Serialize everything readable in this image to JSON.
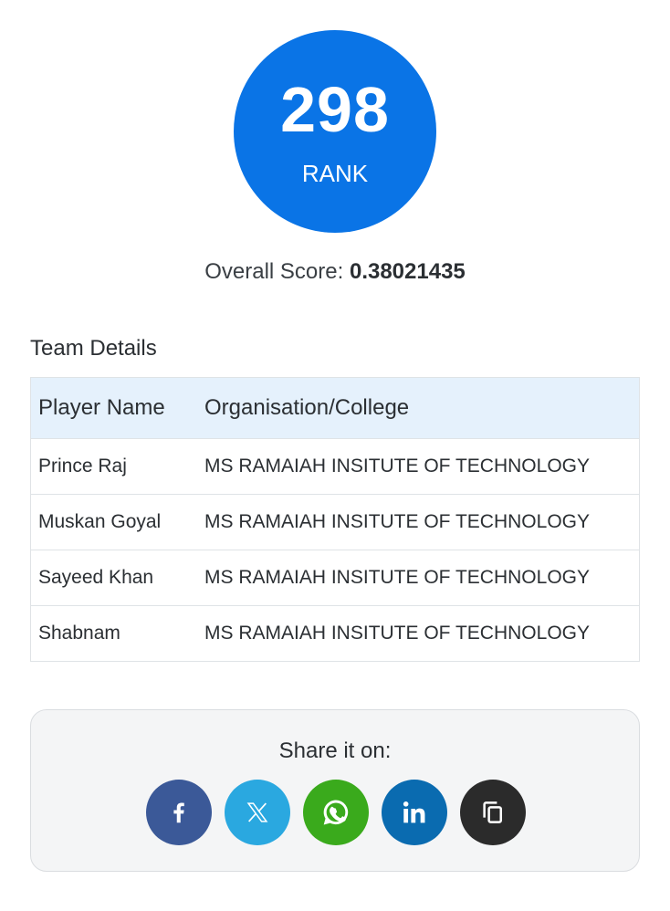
{
  "rank": {
    "number": "298",
    "label": "RANK",
    "color": "#0a74e6"
  },
  "overall_score": {
    "label": "Overall Score:",
    "value": "0.38021435"
  },
  "team": {
    "heading": "Team Details",
    "columns": [
      "Player Name",
      "Organisation/College"
    ],
    "rows": [
      {
        "name": "Prince Raj",
        "org": "MS RAMAIAH INSITUTE OF TECHNOLOGY"
      },
      {
        "name": "Muskan Goyal",
        "org": "MS RAMAIAH INSITUTE OF TECHNOLOGY"
      },
      {
        "name": "Sayeed Khan",
        "org": "MS RAMAIAH INSITUTE OF TECHNOLOGY"
      },
      {
        "name": "Shabnam",
        "org": "MS RAMAIAH INSITUTE OF TECHNOLOGY"
      }
    ]
  },
  "share": {
    "title": "Share it on:",
    "buttons": [
      {
        "icon": "facebook-icon",
        "color": "#3b5998"
      },
      {
        "icon": "x-twitter-icon",
        "color": "#2aa8e0"
      },
      {
        "icon": "whatsapp-icon",
        "color": "#3aaa1c"
      },
      {
        "icon": "linkedin-icon",
        "color": "#0a6bb0"
      },
      {
        "icon": "copy-icon",
        "color": "#2b2b2b"
      }
    ]
  }
}
